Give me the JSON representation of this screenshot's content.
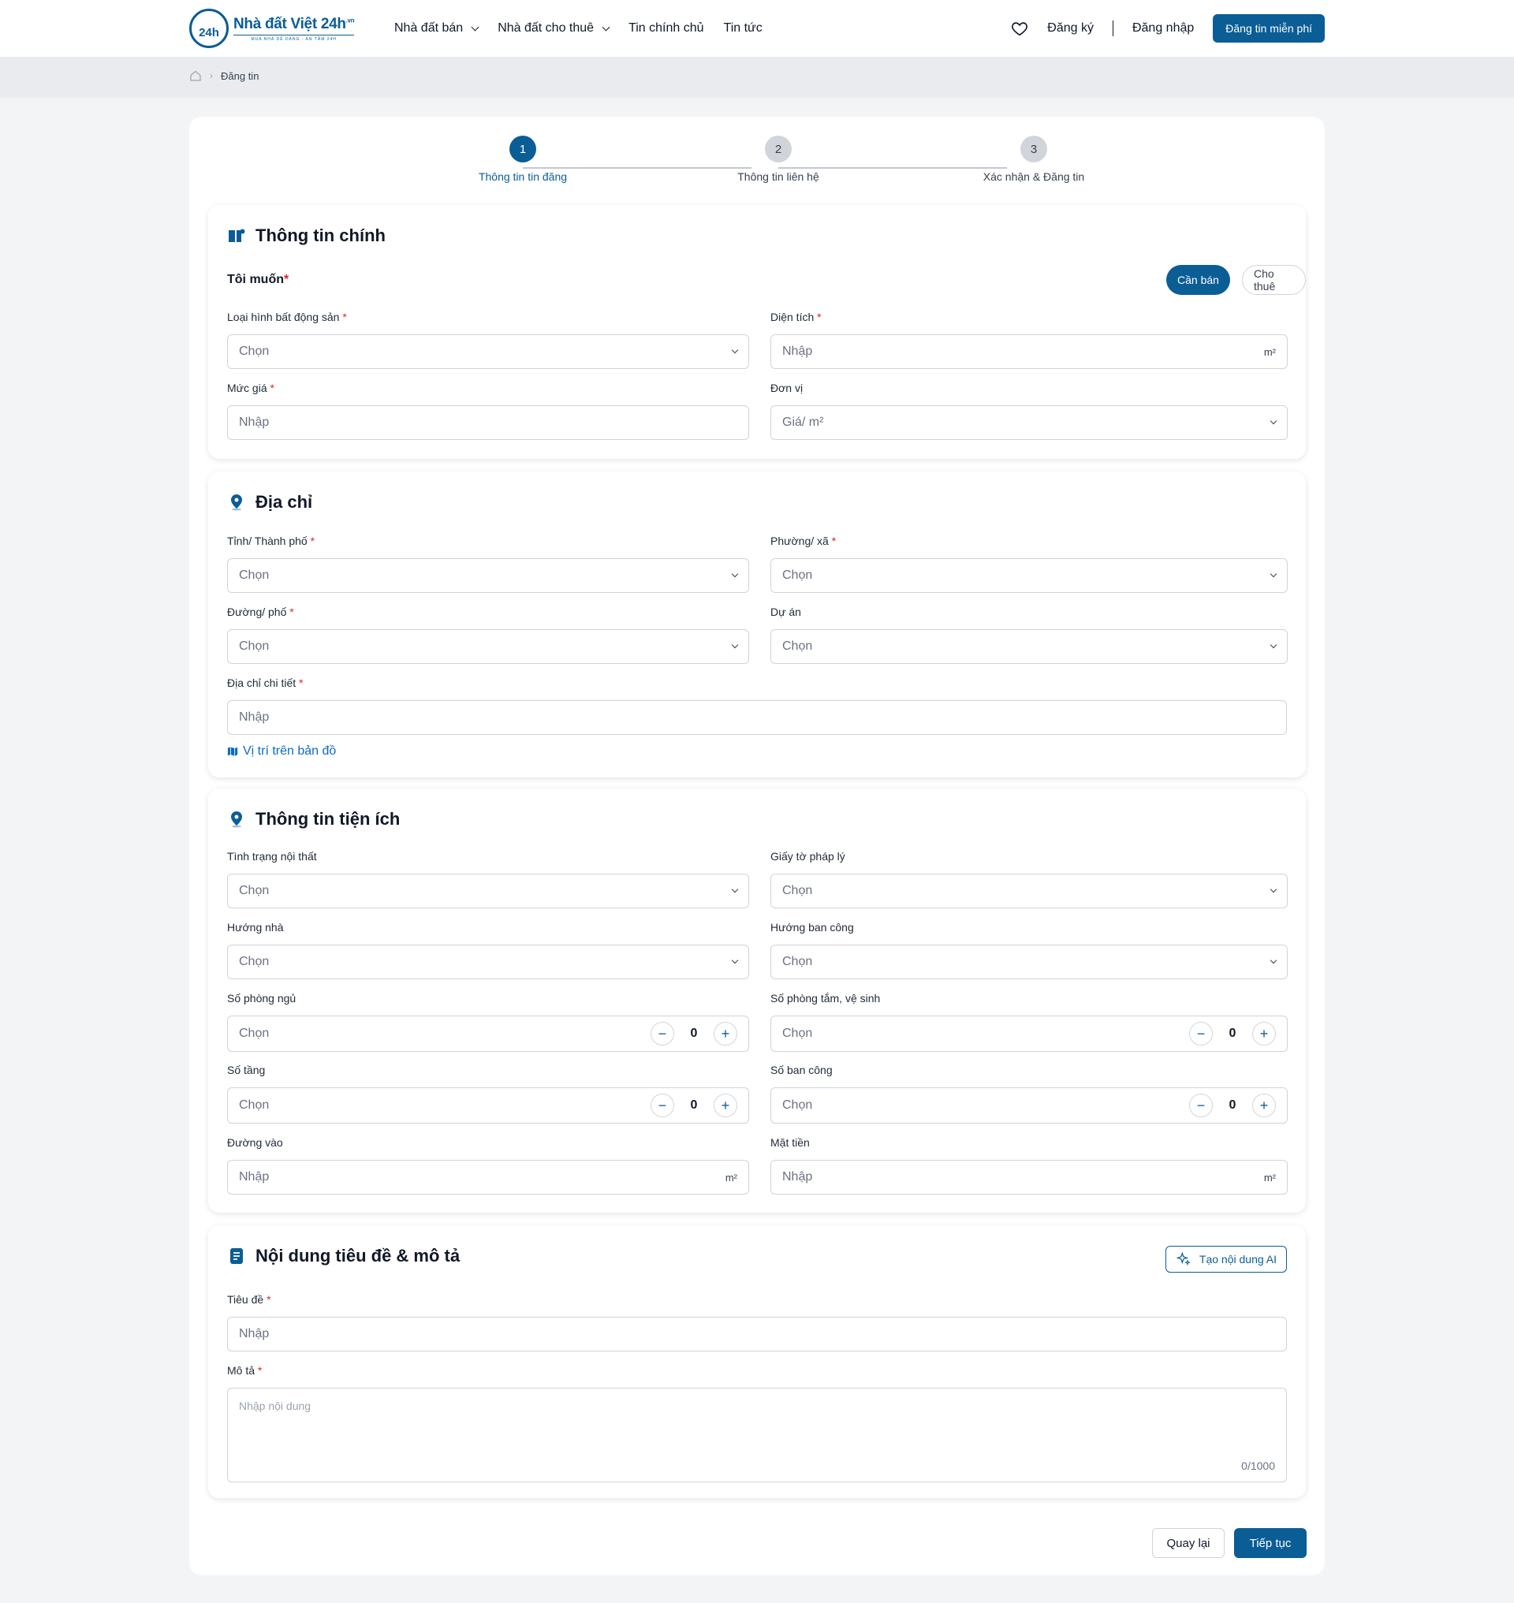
{
  "header": {
    "logo_num": "24h",
    "logo_name": "Nhà đất Việt 24h",
    "logo_suffix": ".vn",
    "logo_tag": "MUA NHÀ DỄ DÀNG - AN TÂM 24H",
    "nav": [
      "Nhà đất bán",
      "Nhà đất cho thuê",
      "Tin chính chủ",
      "Tin tức"
    ],
    "register": "Đăng ký",
    "login": "Đăng nhập",
    "post_button": "Đăng tin miễn phí",
    "brand_color": "#0b5d96"
  },
  "breadcrumb": {
    "current": "Đăng tin"
  },
  "stepper": {
    "steps": [
      {
        "num": "1",
        "label": "Thông tin tin đăng"
      },
      {
        "num": "2",
        "label": "Thông tin liên hệ"
      },
      {
        "num": "3",
        "label": "Xác nhận & Đăng tin"
      }
    ],
    "active": 1
  },
  "main_info": {
    "title": "Thông tin chính",
    "want_label": "Tôi muốn",
    "options": [
      "Cần bán",
      "Cho thuê"
    ],
    "selected": "Cần bán",
    "property_type": {
      "label": "Loại hình bất động sản",
      "placeholder": "Chọn"
    },
    "area": {
      "label": "Diện tích",
      "placeholder": "Nhập",
      "unit": "m²"
    },
    "price": {
      "label": "Mức giá",
      "placeholder": "Nhập"
    },
    "price_unit": {
      "label": "Đơn vị",
      "placeholder": "Giá/ m²"
    }
  },
  "address": {
    "title": "Địa chỉ",
    "province": {
      "label": "Tỉnh/ Thành phố",
      "placeholder": "Chọn"
    },
    "ward": {
      "label": "Phường/ xã",
      "placeholder": "Chọn"
    },
    "street": {
      "label": "Đường/ phố",
      "placeholder": "Chọn"
    },
    "project": {
      "label": "Dự án",
      "placeholder": "Chọn"
    },
    "detail": {
      "label": "Địa chỉ chi tiết",
      "placeholder": "Nhập"
    },
    "map_link": "Vị trí trên bản đồ"
  },
  "amenities": {
    "title": "Thông tin tiện ích",
    "furniture": {
      "label": "Tình trạng nội thất",
      "placeholder": "Chọn"
    },
    "legal": {
      "label": "Giấy tờ pháp lý",
      "placeholder": "Chọn"
    },
    "house_dir": {
      "label": "Hướng nhà",
      "placeholder": "Chọn"
    },
    "balcony_dir": {
      "label": "Hướng ban công",
      "placeholder": "Chọn"
    },
    "bedrooms": {
      "label": "Số phòng ngủ",
      "placeholder": "Chọn",
      "value": "0"
    },
    "bathrooms": {
      "label": "Số phòng tắm, vệ sinh",
      "placeholder": "Chọn",
      "value": "0"
    },
    "floors": {
      "label": "Số tầng",
      "placeholder": "Chọn",
      "value": "0"
    },
    "balconies": {
      "label": "Số ban công",
      "placeholder": "Chọn",
      "value": "0"
    },
    "road": {
      "label": "Đường vào",
      "placeholder": "Nhập",
      "unit": "m²"
    },
    "frontage": {
      "label": "Mặt tiền",
      "placeholder": "Nhập",
      "unit": "m²"
    }
  },
  "content": {
    "title": "Nội dung tiêu đề & mô tả",
    "ai_button": "Tạo nội dung AI",
    "post_title": {
      "label": "Tiêu đề",
      "placeholder": "Nhập"
    },
    "description": {
      "label": "Mô tả",
      "placeholder": "Nhập nội dung",
      "counter": "0/1000"
    }
  },
  "footer": {
    "back": "Quay lại",
    "next": "Tiếp tục"
  }
}
